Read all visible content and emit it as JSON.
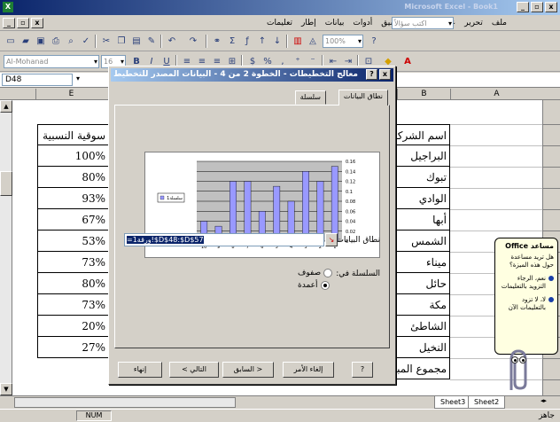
{
  "window": {
    "title": "Microsoft Excel - Book1",
    "min": "_",
    "max": "▫",
    "close": "x"
  },
  "menu": {
    "items": [
      "ملف",
      "تحرير",
      "عرض",
      "إدراج",
      "تنسيق",
      "أدوات",
      "بيانات",
      "إطار",
      "تعليمات"
    ],
    "help_placeholder": "اكتب سؤالاً"
  },
  "toolbar": {
    "font_name": "Al-Mohanad",
    "font_size": "16",
    "zoom": "100%"
  },
  "formula_bar": {
    "name_box": "D48"
  },
  "sheet": {
    "columns": [
      "E",
      "B",
      "A"
    ],
    "left_column": [
      "سوقية النسبية",
      "100%",
      "80%",
      "93%",
      "67%",
      "53%",
      "73%",
      "80%",
      "73%",
      "20%",
      "27%"
    ],
    "right_column": [
      "اسم الشركة",
      "البراجيل",
      "تبوك",
      "الوادي",
      "أبها",
      "الشمس",
      "ميناء",
      "حائل",
      "مكة",
      "الشاطئ",
      "النخيل",
      "مجموع المبيعات"
    ],
    "tabs": [
      "Sheet3",
      "Sheet2"
    ],
    "status_mode": "جاهز",
    "status_num": "NUM"
  },
  "dialog": {
    "title": "معالج التخطيطات - الخطوة 2 من 4 - البيانات المصدر للتخطيط",
    "help": "?",
    "close": "x",
    "tabs": [
      "نطاق البيانات",
      "سلسلة"
    ],
    "data_range_label": "نطاق البيانات:",
    "data_range_value": "=ورقة1!$D$48:$D$57",
    "series_in_label": "السلسلة في:",
    "series_rows_label": "صفوف",
    "series_columns_label": "أعمدة",
    "series_selected": "columns",
    "buttons": {
      "help": "?",
      "cancel": "إلغاء الأمر",
      "back": "< السابق",
      "next": "التالي >",
      "finish": "إنهاء"
    }
  },
  "chart_data": {
    "type": "bar",
    "categories": [
      "1",
      "2",
      "3",
      "4",
      "5",
      "6",
      "7",
      "8",
      "9",
      "10"
    ],
    "values": [
      0.15,
      0.12,
      0.14,
      0.08,
      0.11,
      0.06,
      0.12,
      0.12,
      0.03,
      0.04
    ],
    "ylim": [
      0,
      0.16
    ],
    "yticks": [
      "0",
      "0.02",
      "0.04",
      "0.06",
      "0.08",
      "0.1",
      "0.12",
      "0.14",
      "0.16"
    ],
    "legend": "سلسلة1",
    "bar_color": "#9999ff",
    "plot_bg": "#c0c0c0",
    "grid": true
  },
  "assistant": {
    "header": "مساعد Office",
    "question": "هل تريد مساعدة حول هذه الميزة؟",
    "options": [
      "نعم، الرجاء التزويد بالتعليمات",
      "لا، لا تزود بالتعليمات الآن"
    ]
  }
}
